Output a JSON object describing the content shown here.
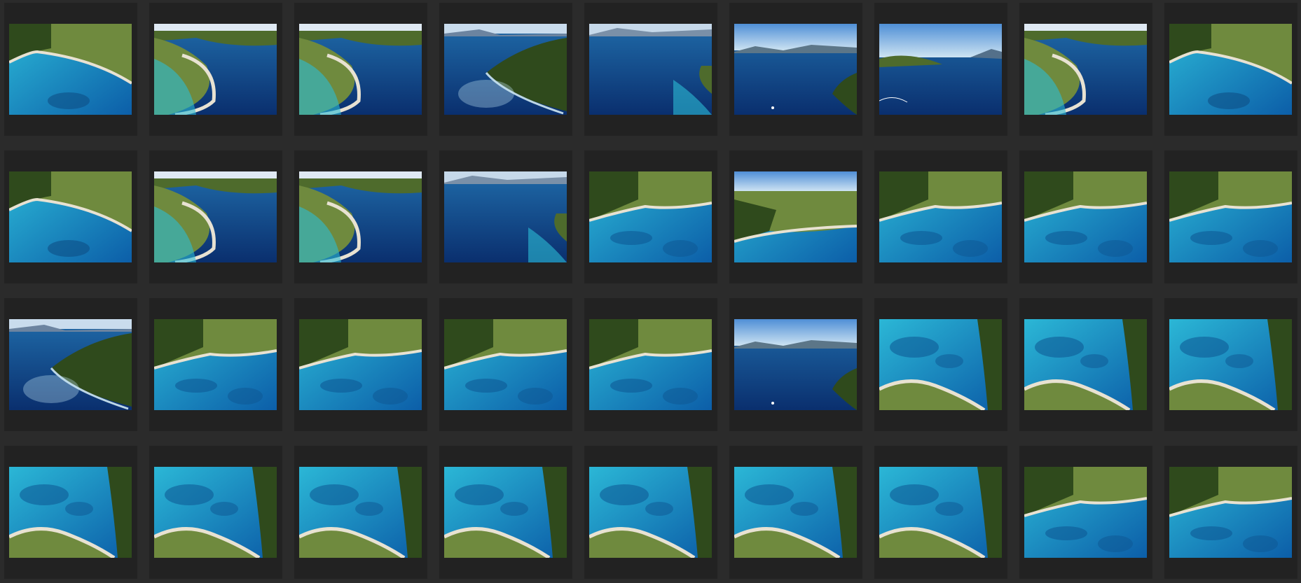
{
  "browser": {
    "title": "",
    "colors": {
      "background": "#2b2b2b",
      "cell": "#222222"
    },
    "thumbnails": [
      {
        "kind": "bay-land-tl"
      },
      {
        "kind": "curved-cove"
      },
      {
        "kind": "curved-cove"
      },
      {
        "kind": "headland-right"
      },
      {
        "kind": "open-sea-horizon"
      },
      {
        "kind": "sky-sea-cliff"
      },
      {
        "kind": "sky-sea-island"
      },
      {
        "kind": "curved-cove"
      },
      {
        "kind": "bay-land-tl"
      },
      {
        "kind": "bay-land-tl"
      },
      {
        "kind": "curved-cove"
      },
      {
        "kind": "curved-cove"
      },
      {
        "kind": "open-sea-horizon"
      },
      {
        "kind": "shore-top"
      },
      {
        "kind": "sky-shore"
      },
      {
        "kind": "shore-top"
      },
      {
        "kind": "shore-top"
      },
      {
        "kind": "shore-top"
      },
      {
        "kind": "headland-right"
      },
      {
        "kind": "shore-top"
      },
      {
        "kind": "shore-top"
      },
      {
        "kind": "shore-top"
      },
      {
        "kind": "shore-top"
      },
      {
        "kind": "sky-sea-cliff"
      },
      {
        "kind": "spit-right"
      },
      {
        "kind": "spit-right"
      },
      {
        "kind": "spit-right"
      },
      {
        "kind": "spit-right"
      },
      {
        "kind": "spit-right"
      },
      {
        "kind": "spit-right"
      },
      {
        "kind": "spit-right"
      },
      {
        "kind": "spit-right"
      },
      {
        "kind": "spit-right"
      },
      {
        "kind": "spit-right"
      },
      {
        "kind": "shore-top"
      },
      {
        "kind": "shore-top"
      }
    ]
  }
}
